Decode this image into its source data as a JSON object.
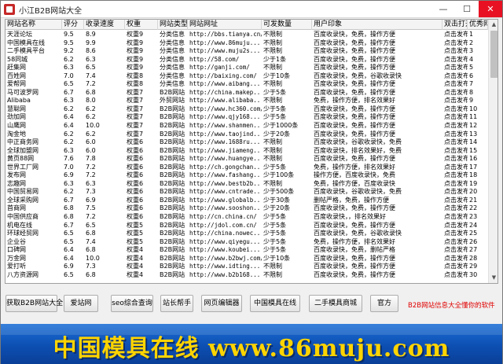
{
  "window": {
    "title": "小江B2B网站大全",
    "min": "—",
    "max": "☐",
    "close": "✕"
  },
  "table": {
    "columns": [
      "网站名称",
      "评分",
      "收录速度",
      "权重",
      "网站类型",
      "网站网址",
      "可发数量",
      "用户印象",
      "双击打开",
      "优秀网站"
    ],
    "rows": [
      [
        "天涯论坛",
        "9.5",
        "8.9",
        "权重9",
        "分类信息",
        "http://bbs.tianya.cn/",
        "不限制",
        "百度收录快，免费，操作方便",
        "点击发布",
        "1"
      ],
      [
        "中国模具在线",
        "9.5",
        "9.9",
        "权重9",
        "分类信息",
        "http://www.86muju...",
        "不限制",
        "百度收录快，免费，操作方便",
        "点击发布",
        "2"
      ],
      [
        "二手模具平台",
        "9.2",
        "8.6",
        "权重9",
        "分类信息",
        "http://www.muju2s...",
        "不限制",
        "百度收录快，免费，操作方便",
        "点击发布",
        "3"
      ],
      [
        "58同城",
        "6.2",
        "6.3",
        "权重9",
        "分类信息",
        "http://58.com/",
        "少于1条",
        "百度收录快，免费，操作方便",
        "点击发布",
        "4"
      ],
      [
        "赶集网",
        "6.3",
        "6.5",
        "权重9",
        "分类信息",
        "http://ganji.com/",
        "不限制",
        "百度收录快，免费，操作方便",
        "点击发布",
        "5"
      ],
      [
        "百姓网",
        "7.0",
        "7.4",
        "权重8",
        "分类信息",
        "http://baixing.com/",
        "少于10条",
        "百度收录快，免费，谷歌收录快",
        "点击发布",
        "6"
      ],
      [
        "爱帮网",
        "6.5",
        "7.2",
        "权重8",
        "分类信息",
        "http://www.aibang...",
        "不限制",
        "百度收录快，免费，操作方便",
        "点击发布",
        "7"
      ],
      [
        "马可波罗网",
        "6.7",
        "6.8",
        "权重7",
        "B2B网站",
        "http://china.makep...",
        "少于5条",
        "百度收录快，免费，操作方便",
        "点击发布",
        "8"
      ],
      [
        "Alibaba",
        "6.3",
        "8.0",
        "权重7",
        "外贸网站",
        "http://www.alibaba...",
        "不限制",
        "免费，操作方便，排名效果好",
        "点击发布",
        "9"
      ],
      [
        "慧聪网",
        "6.2",
        "6.2",
        "权重7",
        "B2B网站",
        "http://www.hc360.com/",
        "少于5条",
        "百度收录快，免费，操作方便",
        "点击发布",
        "10"
      ],
      [
        "劲加网",
        "6.4",
        "6.2",
        "权重7",
        "B2B网站",
        "http://www.qjy168...",
        "少于5条",
        "百度收录快，免费，操作方便",
        "点击发布",
        "11"
      ],
      [
        "山鹰网",
        "6.4",
        "10.0",
        "权重7",
        "B2B网站",
        "http://www.shanmen...",
        "少于1000条",
        "百度收录快，免费，操作方便",
        "点击发布",
        "12"
      ],
      [
        "淘金地",
        "6.2",
        "6.2",
        "权重7",
        "B2B网站",
        "http://www.taojind...",
        "少于20条",
        "百度收录快，免费，操作方便",
        "点击发布",
        "13"
      ],
      [
        "中正商务网",
        "6.2",
        "6.0",
        "权重6",
        "B2B网站",
        "http://www.1688ru...",
        "不限制",
        "百度收录快，谷歌收录快，免费",
        "点击发布",
        "14"
      ],
      [
        "全球加盟网",
        "6.3",
        "6.0",
        "权重6",
        "B2B网站",
        "http://www.jiameng...",
        "不限制",
        "百度收录快，排名效果好，免费",
        "点击发布",
        "15"
      ],
      [
        "黄页88网",
        "7.6",
        "7.8",
        "权重6",
        "B2B网站",
        "http://www.huangye...",
        "不限制",
        "百度收录快，免费，操作方便",
        "点击发布",
        "16"
      ],
      [
        "世界工厂网",
        "7.0",
        "7.2",
        "权重6",
        "B2B网站",
        "http://ch.gongchan...",
        "少于5条",
        "免费，操作方便，排名效果好",
        "点击发布",
        "17"
      ],
      [
        "发布网",
        "6.9",
        "7.2",
        "权重6",
        "B2B网站",
        "http://www.fashang...",
        "少于100条",
        "操作方便，百度收录快，免费",
        "点击发布",
        "18"
      ],
      [
        "志趣网",
        "6.3",
        "6.3",
        "权重6",
        "B2B网站",
        "http://www.bestb2b...",
        "不限制",
        "免费，操作方便，百度收录快",
        "点击发布",
        "19"
      ],
      [
        "中国贸易网",
        "6.2",
        "7.3",
        "权重6",
        "B2B网站",
        "http://www.cntrade...",
        "少于500条",
        "百度收录快，谷歌收录快，免费",
        "点击发布",
        "20"
      ],
      [
        "全球采购网",
        "6.7",
        "6.9",
        "权重6",
        "B2B网站",
        "http://www.globalb...",
        "少于30条",
        "删帖严格，免费，操作方便",
        "点击发布",
        "21"
      ],
      [
        "首商网",
        "6.8",
        "7.5",
        "权重6",
        "B2B网站",
        "http://www.sooshon...",
        "少于20条",
        "百度收录快，免费，操作方便",
        "点击发布",
        "22"
      ],
      [
        "中国供应商",
        "6.8",
        "7.2",
        "权重6",
        "B2B网站",
        "http://cn.china.cn/",
        "少于5条",
        "百度收录快，，排名效果好",
        "点击发布",
        "23"
      ],
      [
        "机电在线",
        "6.7",
        "6.5",
        "权重5",
        "B2B网站",
        "http://jdol.com.cn/",
        "少于5条",
        "百度收录快，免费，操作方便",
        "点击发布",
        "24"
      ],
      [
        "环球经贸网",
        "6.5",
        "6.8",
        "权重5",
        "B2B网站",
        "http://china.nowec...",
        "少于5条",
        "百度收录快，免费，谷歌收录快",
        "点击发布",
        "25"
      ],
      [
        "企业谷",
        "6.5",
        "7.4",
        "权重5",
        "B2B网站",
        "http://www.qiyegu...",
        "少于5条",
        "免费，操作方便，排名效果好",
        "点击发布",
        "26"
      ],
      [
        "口碑网",
        "6.4",
        "6.8",
        "权重4",
        "B2B网站",
        "http://www.koubei...",
        "少于5条",
        "百度收录快，免费，删帖严格",
        "点击发布",
        "27"
      ],
      [
        "万金网",
        "6.4",
        "10.0",
        "权重4",
        "B2B网站",
        "http://www.b2bwj.com/",
        "少于10条",
        "百度收录快，免费，操作方便",
        "点击发布",
        "28"
      ],
      [
        "爱打听",
        "6.9",
        "7.3",
        "权重4",
        "B2B网站",
        "http://www.idting...",
        "不限制",
        "百度收录快，免费，操作方便",
        "点击发布",
        "29"
      ],
      [
        "八方资源网",
        "6.5",
        "6.8",
        "权重4",
        "B2B网站",
        "http://www.b2b168...",
        "不限制",
        "百度收录快，免费，操作方便",
        "点击发布",
        "30"
      ]
    ]
  },
  "scrollbar": {
    "up": "▲",
    "down": "▼"
  },
  "toolbar": {
    "buttons": [
      "获取B2B网站大全",
      "爱站网",
      "seo综合查询",
      "站长帮手",
      "网页编辑器",
      "中国模具在线",
      "二手模具商城",
      "官方"
    ],
    "slogan": "B2B网站信息大全懂你的软件",
    "slogan_color": "#e00000"
  },
  "banner": {
    "text": "中国模具在线 www.86muju.com",
    "text_color": "#ffd400",
    "bg_color": "#0d4fb2"
  }
}
